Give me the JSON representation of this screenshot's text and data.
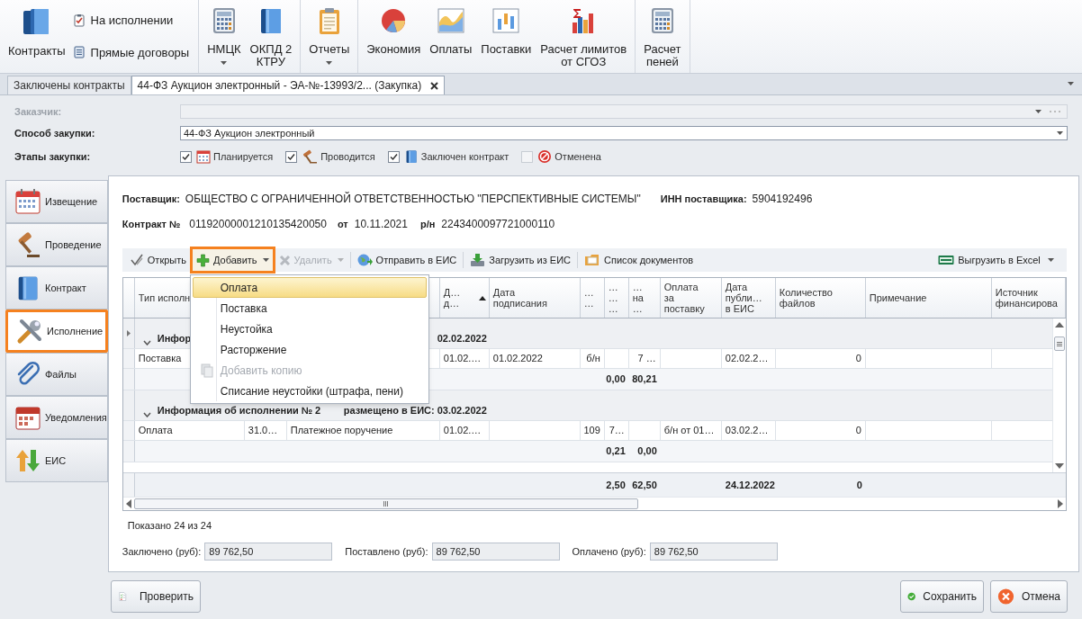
{
  "ribbon": {
    "groups": [
      {
        "items": [
          {
            "label": "Контракты",
            "kind": "large",
            "has_menu": false
          },
          {
            "label": "На исполнении",
            "kind": "small"
          },
          {
            "label": "Прямые договоры",
            "kind": "small"
          }
        ]
      },
      {
        "items": [
          {
            "label": "НМЦК",
            "kind": "large",
            "has_menu": true
          },
          {
            "label": "ОКПД 2\nКТРУ",
            "kind": "large",
            "has_menu": false
          }
        ]
      },
      {
        "items": [
          {
            "label": "Отчеты",
            "kind": "large",
            "has_menu": true
          }
        ]
      },
      {
        "items": [
          {
            "label": "Экономия",
            "kind": "large",
            "has_menu": false
          },
          {
            "label": "Оплаты",
            "kind": "large",
            "has_menu": false
          },
          {
            "label": "Поставки",
            "kind": "large",
            "has_menu": false
          },
          {
            "label": "Расчет лимитов\nот СГОЗ",
            "kind": "large",
            "has_menu": false
          }
        ]
      },
      {
        "items": [
          {
            "label": "Расчет\nпеней",
            "kind": "large",
            "has_menu": false
          }
        ]
      }
    ]
  },
  "tabs": [
    {
      "label": "Заключены контракты",
      "selected": false,
      "closable": false
    },
    {
      "label": "44-ФЗ Аукцион электронный - ЭА-№-13993/2... (Закупка)",
      "selected": true,
      "closable": true
    }
  ],
  "form": {
    "customer": {
      "label": "Заказчик:",
      "disabled": true
    },
    "method": {
      "label": "Способ закупки:",
      "value": "44-ФЗ Аукцион электронный"
    },
    "stages": {
      "label": "Этапы закупки:",
      "items": [
        {
          "label": "Планируется",
          "checked": true
        },
        {
          "label": "Проводится",
          "checked": true
        },
        {
          "label": "Заключен контракт",
          "checked": true
        },
        {
          "label": "Отменена",
          "checked": false
        }
      ]
    }
  },
  "nav": [
    {
      "label": "Извещение",
      "selected": false
    },
    {
      "label": "Проведение",
      "selected": false
    },
    {
      "label": "Контракт",
      "selected": false
    },
    {
      "label": "Исполнение",
      "selected": true
    },
    {
      "label": "Файлы",
      "selected": false
    },
    {
      "label": "Уведомления",
      "selected": false
    },
    {
      "label": "ЕИС",
      "selected": false
    }
  ],
  "supplier": {
    "label": "Поставщик:",
    "value": "ОБЩЕСТВО С ОГРАНИЧЕННОЙ ОТВЕТСТВЕННОСТЬЮ \"ПЕРСПЕКТИВНЫЕ СИСТЕМЫ\"",
    "inn_label": "ИНН поставщика:",
    "inn": "5904192496"
  },
  "contract": {
    "label": "Контракт №",
    "number": "01192000001210135420050",
    "date_label": "от",
    "date": "10.11.2021",
    "reg_label": "р/н",
    "reg": "2243400097721000110"
  },
  "toolbar": {
    "items": [
      {
        "label": "Открыть",
        "disabled": false,
        "has_menu": false,
        "highlighted": false
      },
      {
        "label": "Добавить",
        "disabled": false,
        "has_menu": true,
        "highlighted": true
      },
      {
        "label": "Удалить",
        "disabled": true,
        "has_menu": true,
        "highlighted": false
      },
      {
        "label": "Отправить в ЕИС",
        "disabled": false,
        "has_menu": false,
        "highlighted": false
      },
      {
        "label": "Загрузить из ЕИС",
        "disabled": false,
        "has_menu": false,
        "highlighted": false
      },
      {
        "label": "Список документов",
        "disabled": false,
        "has_menu": false,
        "highlighted": false
      }
    ],
    "export": {
      "label": "Выгрузить в Excel",
      "has_menu": true
    }
  },
  "menu": [
    {
      "label": "Оплата",
      "selected": true,
      "disabled": false
    },
    {
      "label": "Поставка",
      "selected": false,
      "disabled": false
    },
    {
      "label": "Неустойка",
      "selected": false,
      "disabled": false
    },
    {
      "label": "Расторжение",
      "selected": false,
      "disabled": false
    },
    {
      "label": "Добавить копию",
      "selected": false,
      "disabled": true
    },
    {
      "label": "Списание неустойки (штрафа, пени)",
      "selected": false,
      "disabled": false
    }
  ],
  "grid": {
    "columns": [
      {
        "label": "Тип исполн",
        "sorted_ascending": false
      },
      {
        "label": "Д…\nд…",
        "sorted_ascending": true
      },
      {
        "label": "Дата\nподписания",
        "sorted_ascending": false
      },
      {
        "label": "…\n…",
        "sorted_ascending": false
      },
      {
        "label": "…\n…\n…",
        "sorted_ascending": false
      },
      {
        "label": "…\nна\n…",
        "sorted_ascending": false
      },
      {
        "label": "Оплата\nза\nпоставку",
        "sorted_ascending": false
      },
      {
        "label": "Дата\nпубли…\nв ЕИС",
        "sorted_ascending": false
      },
      {
        "label": "Количество\nфайлов",
        "sorted_ascending": false
      },
      {
        "label": "Примечание",
        "sorted_ascending": false
      },
      {
        "label": "Источник\nфинансирова",
        "sorted_ascending": false
      }
    ],
    "groups": [
      {
        "title": "Инфор",
        "published": "02.02.2022",
        "current": true,
        "rows": [
          {
            "type": "Поставка",
            "column_4": "01.02.…",
            "signed": "01.02.2022",
            "column_6": "б/н",
            "column_8": "7 …",
            "published": "02.02.2…",
            "files": "0"
          }
        ],
        "summary": {
          "column_7": "0,00",
          "column_8": "80,21"
        }
      },
      {
        "title": "Информация об исполнении № 2",
        "published": "размещено в ЕИС: 03.02.2022",
        "current": false,
        "rows": [
          {
            "type": "Оплата",
            "column_2": "31.0…",
            "column_3": "Платежное поручение",
            "column_4": "01.02.…",
            "column_6": "109",
            "column_7": "7…",
            "payment": "б/н от 01…",
            "published": "03.02.2…",
            "files": "0"
          }
        ],
        "summary": {
          "column_7": "0,21",
          "column_8": "0,00"
        }
      }
    ],
    "totals": {
      "column_7": "2,50",
      "column_8": "62,50",
      "published": "24.12.2022",
      "files": "0"
    }
  },
  "shown": "Показано 24 из 24",
  "sums": [
    {
      "label": "Заключено (руб):",
      "value": "89 762,50"
    },
    {
      "label": "Поставлено (руб):",
      "value": "89 762,50"
    },
    {
      "label": "Оплачено (руб):",
      "value": "89 762,50"
    }
  ],
  "buttons": {
    "check": "Проверить",
    "save": "Сохранить",
    "cancel": "Отмена"
  }
}
